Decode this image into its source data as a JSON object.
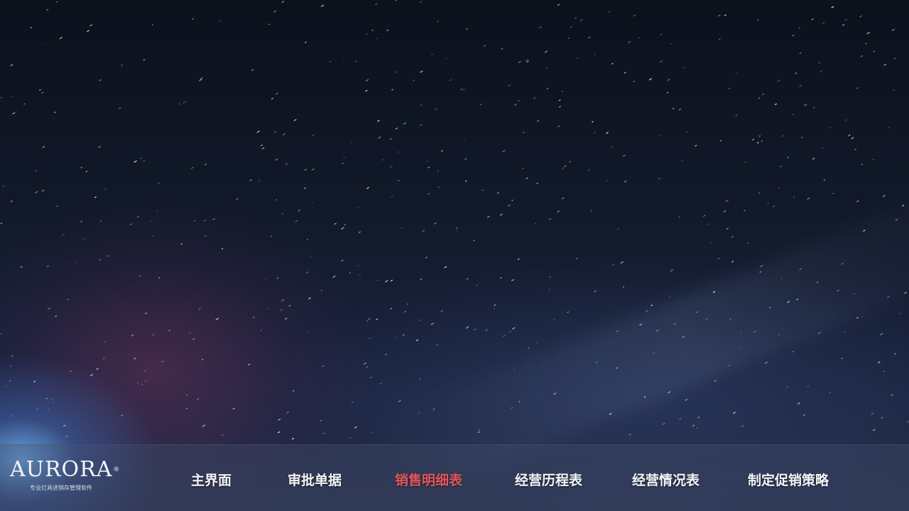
{
  "app": {
    "logo_text": "AURORA",
    "logo_registered": "®",
    "logo_tagline": "专业灯具进销存管理软件"
  },
  "nav": {
    "active_color": "#e2575c",
    "items": [
      {
        "label": "主界面",
        "active": false
      },
      {
        "label": "审批单据",
        "active": false
      },
      {
        "label": "销售明细表",
        "active": true
      },
      {
        "label": "经营历程表",
        "active": false
      },
      {
        "label": "经营情况表",
        "active": false
      },
      {
        "label": "制定促销策略",
        "active": false
      }
    ]
  }
}
